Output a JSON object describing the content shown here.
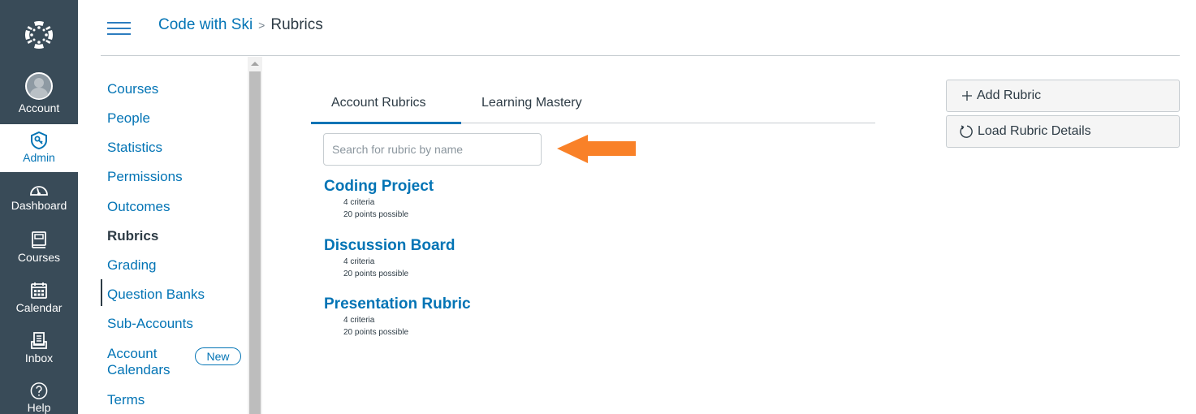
{
  "global_nav": {
    "logo": "canvas-logo-icon",
    "items": [
      {
        "label": "Account",
        "icon": "avatar-icon"
      },
      {
        "label": "Admin",
        "icon": "admin-shield-icon",
        "active": true
      },
      {
        "label": "Dashboard",
        "icon": "dashboard-icon"
      },
      {
        "label": "Courses",
        "icon": "courses-book-icon"
      },
      {
        "label": "Calendar",
        "icon": "calendar-icon"
      },
      {
        "label": "Inbox",
        "icon": "inbox-icon"
      },
      {
        "label": "Help",
        "icon": "help-icon"
      }
    ]
  },
  "header": {
    "breadcrumb": [
      {
        "label": "Code with Ski",
        "link": true
      },
      {
        "label": "Rubrics",
        "link": false
      }
    ],
    "separator": ">"
  },
  "section_nav": {
    "items": [
      {
        "label": "Courses"
      },
      {
        "label": "People"
      },
      {
        "label": "Statistics"
      },
      {
        "label": "Permissions"
      },
      {
        "label": "Outcomes"
      },
      {
        "label": "Rubrics",
        "active": true
      },
      {
        "label": "Grading"
      },
      {
        "label": "Question Banks"
      },
      {
        "label": "Sub-Accounts"
      },
      {
        "label": "Account Calendars",
        "line1": "Account",
        "line2": "Calendars",
        "badge": "New"
      },
      {
        "label": "Terms"
      }
    ]
  },
  "main": {
    "tabs": [
      {
        "label": "Account Rubrics",
        "active": true
      },
      {
        "label": "Learning Mastery",
        "active": false
      }
    ],
    "search": {
      "value": "",
      "placeholder": "Search for rubric by name"
    },
    "annotation": {
      "type": "arrow",
      "direction": "left",
      "color": "#f98128"
    },
    "rubrics": [
      {
        "title": "Coding Project",
        "criteria": "4 criteria",
        "points": "20 points possible"
      },
      {
        "title": "Discussion Board",
        "criteria": "4 criteria",
        "points": "20 points possible"
      },
      {
        "title": "Presentation Rubric",
        "criteria": "4 criteria",
        "points": "20 points possible"
      }
    ]
  },
  "actions": {
    "add_rubric": {
      "label": "Add Rubric",
      "icon": "plus-icon"
    },
    "load_details": {
      "label": "Load Rubric Details",
      "icon": "refresh-icon"
    }
  },
  "colors": {
    "nav_bg": "#394b58",
    "link": "#0374b5",
    "text": "#2d3b45",
    "accent_arrow": "#f98128"
  }
}
